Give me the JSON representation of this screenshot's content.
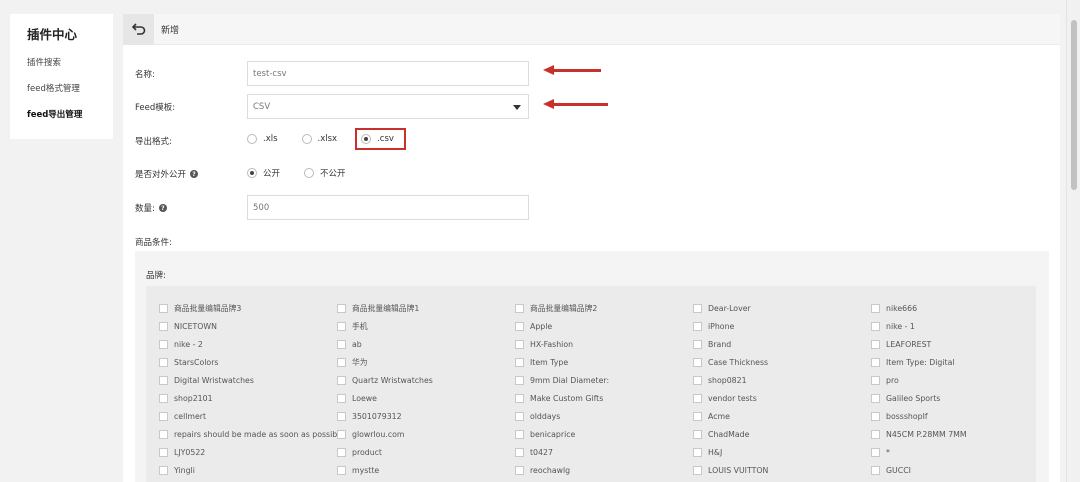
{
  "sidebar": {
    "title": "插件中心",
    "items": [
      {
        "label": "插件搜索"
      },
      {
        "label": "feed格式管理"
      },
      {
        "label": "feed导出管理"
      }
    ]
  },
  "topbar": {
    "crumb": "新增"
  },
  "form": {
    "name": {
      "label": "名称:",
      "value": "test-csv"
    },
    "template": {
      "label": "Feed模板:",
      "value": "CSV"
    },
    "export_format": {
      "label": "导出格式:",
      "options": [
        ".xls",
        ".xlsx",
        ".csv"
      ],
      "selected": ".csv"
    },
    "public": {
      "label": "是否对外公开",
      "options": [
        "公开",
        "不公开"
      ],
      "selected": "公开"
    },
    "quantity": {
      "label": "数量:",
      "value": "500"
    },
    "conditions_label": "商品条件:"
  },
  "brands": {
    "label": "品牌:",
    "rows": [
      [
        "商品批量编辑品牌3",
        "商品批量编辑品牌1",
        "商品批量编辑品牌2",
        "Dear-Lover",
        "nike666"
      ],
      [
        "NICETOWN",
        "手机",
        "Apple",
        "iPhone",
        "nike - 1"
      ],
      [
        "nike - 2",
        "ab",
        "HX-Fashion",
        "Brand",
        "LEAFOREST"
      ],
      [
        "StarsColors",
        "华为",
        "Item Type",
        "Case Thickness",
        "Item Type: Digital"
      ],
      [
        "Digital Wristwatches",
        "Quartz Wristwatches",
        "9mm Dial Diameter:",
        "shop0821",
        "pro"
      ],
      [
        "shop2101",
        "Loewe",
        "Make Custom Gifts",
        "vendor tests",
        "Galileo Sports"
      ],
      [
        "cellmert",
        "3501079312",
        "olddays",
        "Acme",
        "bossshopIf"
      ],
      [
        "repairs should be made as soon as possible",
        "glowrlou.com",
        "benicaprice",
        "ChadMade",
        "N45CM P.28MM 7MM"
      ],
      [
        "LJY0522",
        "product",
        "t0427",
        "H&J",
        "*"
      ],
      [
        "Yingli",
        "mystte",
        "reochawlg",
        "LOUIS VUITTON",
        "GUCCI"
      ]
    ]
  },
  "colors": {
    "accent": "#c9302c"
  }
}
